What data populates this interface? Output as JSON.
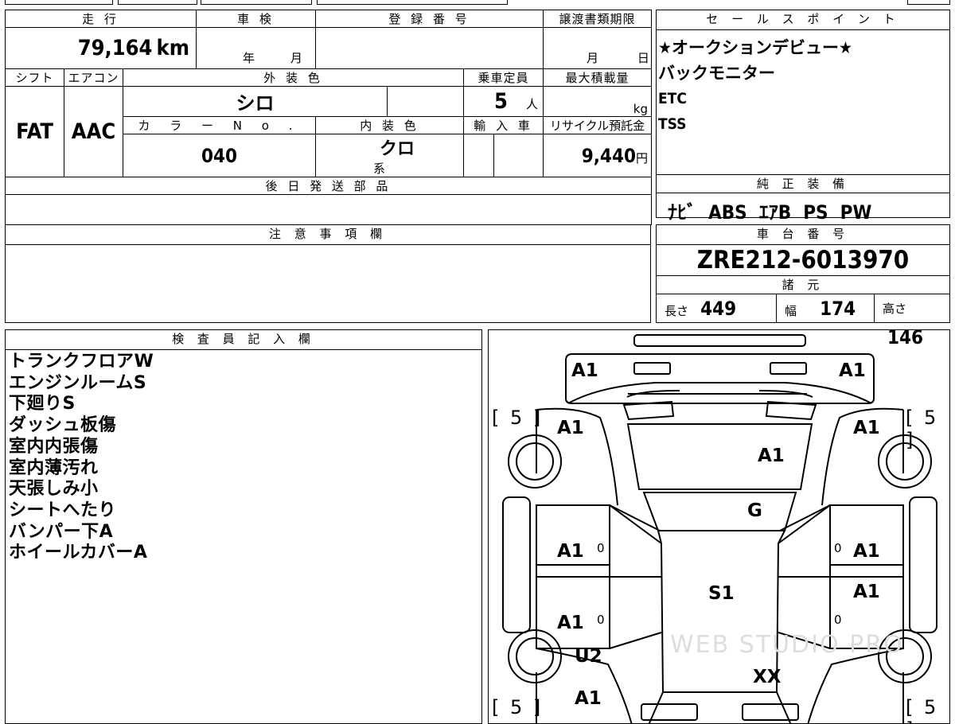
{
  "header_labels": {
    "mileage": "走 行",
    "inspection": "車 検",
    "registration": "登 録 番 号",
    "transfer_deadline": "譲渡書類期限",
    "sales_points": "セ ー ル ス ポ イ ン ト",
    "shift": "シフト",
    "aircon": "エアコン",
    "exterior_color": "外 装 色",
    "capacity": "乗車定員",
    "max_load": "最大積載量",
    "color_no": "カ ラ ー N o .",
    "interior_color": "内 装 色",
    "import": "輸 入 車",
    "recycle": "リサイクル預託金",
    "later_parts": "後 日 発 送 部 品",
    "equipment": "純 正 装 備",
    "notes": "注 意 事 項 欄",
    "chassis_no": "車 台 番 号",
    "specs": "諸 元",
    "inspector": "検 査 員 記 入 欄"
  },
  "values": {
    "mileage": "79,164",
    "mileage_unit": "km",
    "inspection_year": "年",
    "inspection_month": "月",
    "transfer_month": "月",
    "transfer_day": "日",
    "shift": "FAT",
    "aircon": "AAC",
    "exterior_color": "シロ",
    "capacity": "5",
    "capacity_unit": "人",
    "max_load_unit": "kg",
    "color_no": "040",
    "interior_color": "クロ",
    "interior_suffix": "系",
    "recycle_fee": "9,440",
    "recycle_unit": "円",
    "chassis_no": "ZRE212-6013970",
    "length_label": "長さ",
    "length": "449",
    "width_label": "幅",
    "width": "174",
    "height_label": "高さ",
    "height": "146"
  },
  "sales_points": [
    "★オークションデビュー★",
    "バックモニター",
    "ETC",
    "TSS"
  ],
  "equipment": "ﾅﾋﾞ  ABS  ｴｱB  PS  PW",
  "inspector_remarks": [
    "トランクフロアW",
    "エンジンルームS",
    "下廻りS",
    "ダッシュ板傷",
    "室内内張傷",
    "室内薄汚れ",
    "天張しみ小",
    "シートへたり",
    "バンパー下A",
    "ホイールカバーA"
  ],
  "diagram": {
    "tire_brackets": [
      "[ 5 ]",
      "[ 5 ]",
      "[ 5 ]",
      "[ 5 ]"
    ],
    "labels": {
      "rear_left": "A1",
      "rear_right": "A1",
      "quarter_left": "A1",
      "quarter_right": "A1",
      "trunk": "A1",
      "rear_glass": "G",
      "rear_door_left": "A1",
      "rear_door_right": "A1",
      "front_door_left": "A1",
      "front_door_right": "A1",
      "roof": "S1",
      "fender_left": "U2",
      "hood": "XX",
      "front_left": "A1"
    },
    "zero": "0"
  },
  "watermark": "WEB STUDIO PRO"
}
